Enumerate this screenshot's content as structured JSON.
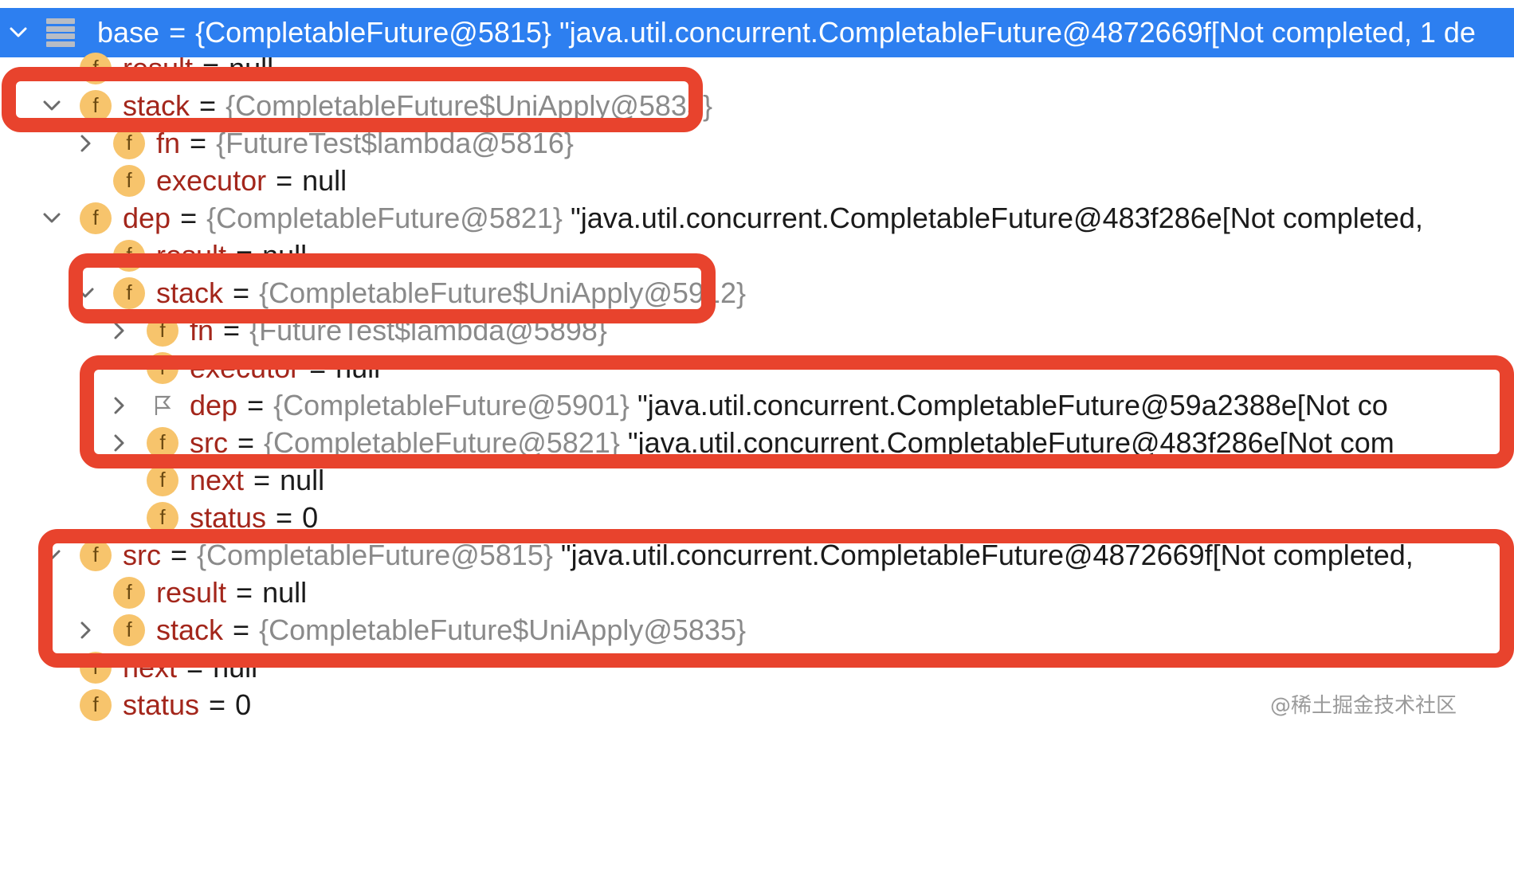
{
  "window": {
    "title": "Debugger Variables"
  },
  "tree": {
    "rows": [
      {
        "chev": "down",
        "icon": "list",
        "name": "base",
        "ref": "{CompletableFuture@5815}",
        "val": "\"java.util.concurrent.CompletableFuture@4872669f[Not completed, 1 de",
        "header": true
      },
      {
        "chev": "",
        "icon": "field",
        "name": "result",
        "eq": "=",
        "plain": "null"
      },
      {
        "chev": "down",
        "icon": "field",
        "name": "stack",
        "eq": "=",
        "ref": "{CompletableFuture$UniApply@5835}"
      },
      {
        "chev": "right",
        "icon": "field",
        "name": "fn",
        "eq": "=",
        "ref": "{FutureTest$lambda@5816}"
      },
      {
        "chev": "",
        "icon": "field",
        "name": "executor",
        "eq": "=",
        "plain": "null"
      },
      {
        "chev": "down",
        "icon": "field",
        "name": "dep",
        "eq": "=",
        "ref": "{CompletableFuture@5821}",
        "val": "\"java.util.concurrent.CompletableFuture@483f286e[Not completed,"
      },
      {
        "chev": "",
        "icon": "field",
        "name": "result",
        "eq": "=",
        "plain": "null"
      },
      {
        "chev": "down",
        "icon": "field",
        "name": "stack",
        "eq": "=",
        "ref": "{CompletableFuture$UniApply@5912}"
      },
      {
        "chev": "right",
        "icon": "field",
        "name": "fn",
        "eq": "=",
        "ref": "{FutureTest$lambda@5898}"
      },
      {
        "chev": "",
        "icon": "field",
        "name": "executor",
        "eq": "=",
        "plain": "null"
      },
      {
        "chev": "right",
        "icon": "flag",
        "name": "dep",
        "eq": "=",
        "ref": "{CompletableFuture@5901}",
        "val": "\"java.util.concurrent.CompletableFuture@59a2388e[Not co"
      },
      {
        "chev": "right",
        "icon": "field",
        "name": "src",
        "eq": "=",
        "ref": "{CompletableFuture@5821}",
        "val": "\"java.util.concurrent.CompletableFuture@483f286e[Not com"
      },
      {
        "chev": "",
        "icon": "field",
        "name": "next",
        "eq": "=",
        "plain": "null"
      },
      {
        "chev": "",
        "icon": "field",
        "name": "status",
        "eq": "=",
        "plain": "0"
      },
      {
        "chev": "down",
        "icon": "field",
        "name": "src",
        "eq": "=",
        "ref": "{CompletableFuture@5815}",
        "val": "\"java.util.concurrent.CompletableFuture@4872669f[Not completed,"
      },
      {
        "chev": "",
        "icon": "field",
        "name": "result",
        "eq": "=",
        "plain": "null"
      },
      {
        "chev": "right",
        "icon": "field",
        "name": "stack",
        "eq": "=",
        "ref": "{CompletableFuture$UniApply@5835}"
      },
      {
        "chev": "",
        "icon": "field",
        "name": "next",
        "eq": "=",
        "plain": "null"
      },
      {
        "chev": "",
        "icon": "field",
        "name": "status",
        "eq": "=",
        "plain": "0"
      }
    ]
  },
  "badge_letter": "f",
  "header_eq": "=",
  "watermark": "@稀土掘金技术社区",
  "colors": {
    "header": "#2d7ff0",
    "highlight": "#e8432d",
    "badge": "#f7c46c",
    "field_name": "#a3261b"
  }
}
